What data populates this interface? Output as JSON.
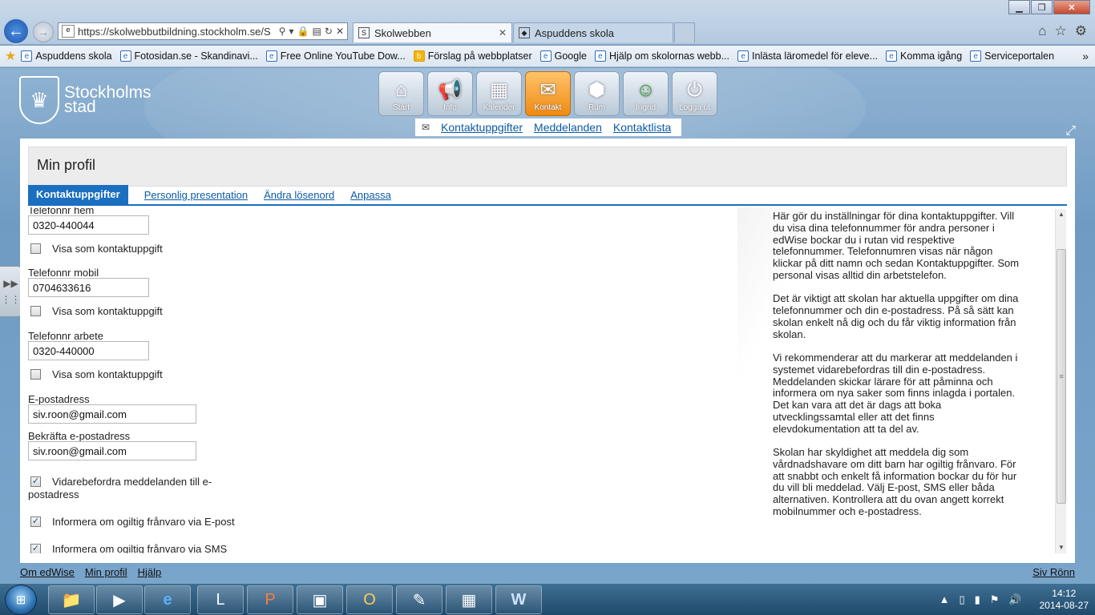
{
  "browser": {
    "url": "https://skolwebbutbildning.stockholm.se/Se",
    "tabs": [
      {
        "title": "Skolwebben",
        "close": "✕"
      },
      {
        "title": "Aspuddens skola"
      }
    ],
    "favorites": [
      "Aspuddens skola",
      "Fotosidan.se - Skandinavi...",
      "Free Online YouTube Dow...",
      "Förslag på webbplatser",
      "Google",
      "Hjälp om skolornas webb...",
      "Inlästa läromedel för eleve...",
      "Komma igång",
      "Serviceportalen"
    ],
    "favorites_more": "»"
  },
  "logo": {
    "line1": "Stockholms",
    "line2": "stad"
  },
  "nav": [
    {
      "label": "Start",
      "icon": "home-icon",
      "glyph": "⌂"
    },
    {
      "label": "Info",
      "icon": "megaphone-icon",
      "glyph": "📢"
    },
    {
      "label": "Kalender",
      "icon": "calendar-icon",
      "glyph": "▦"
    },
    {
      "label": "Kontakt",
      "icon": "envelope-icon",
      "glyph": "✉"
    },
    {
      "label": "Rum",
      "icon": "cube-icon",
      "glyph": "⬢"
    },
    {
      "label": "Ingrid",
      "icon": "user-add-icon",
      "glyph": "☺"
    },
    {
      "label": "Logga ut",
      "icon": "power-icon",
      "glyph": "⏻"
    }
  ],
  "subnav": [
    "Kontaktuppgifter",
    "Meddelanden",
    "Kontaktlista"
  ],
  "page": {
    "title": "Min profil",
    "tabs": [
      "Kontaktuppgifter",
      "Personlig presentation",
      "Ändra lösenord",
      "Anpassa"
    ]
  },
  "form": {
    "phone_home_label": "Telefonnr hem",
    "phone_home_value": "0320-440044",
    "show_contact_label": "Visa som kontaktuppgift",
    "phone_mobile_label": "Telefonnr mobil",
    "phone_mobile_value": "0704633616",
    "phone_work_label": "Telefonnr arbete",
    "phone_work_value": "0320-440000",
    "email_label": "E-postadress",
    "email_value": "siv.roon@gmail.com",
    "email_confirm_label": "Bekräfta e-postadress",
    "email_confirm_value": "siv.roon@gmail.com",
    "forward_label_1": "Vidarebefordra meddelanden till e-",
    "forward_label_2": "postadress",
    "absence_email_label": "Informera om ogiltig frånvaro via E-post",
    "absence_sms_label": "Informera om ogiltig frånvaro via SMS",
    "checks": {
      "show_home": false,
      "show_mobile": false,
      "show_work": false,
      "forward": true,
      "absence_email": true,
      "absence_sms": true
    }
  },
  "help": {
    "p1": "Här gör du inställningar för dina kontaktuppgifter. Vill du visa dina telefonnummer för andra personer i edWise bockar du i rutan vid respektive telefonnummer. Telefonnumren visas när någon klickar på ditt namn och sedan Kontaktuppgifter. Som personal visas alltid din arbetstelefon.",
    "p2": "Det är viktigt att skolan har aktuella uppgifter om dina telefonnummer och din e-postadress. På så sätt kan skolan enkelt nå dig och du får viktig information från skolan.",
    "p3": "Vi rekommenderar att du markerar att meddelanden i systemet vidarebefordras till din e-postadress. Meddelanden skickar lärare för att påminna och informera om nya saker som finns inlagda i portalen. Det kan vara att det är dags att boka utvecklingssamtal eller att det finns elevdokumentation att ta del av.",
    "p4": "Skolan har skyldighet att meddela dig som vårdnadshavare om ditt barn har ogiltig frånvaro. För att snabbt och enkelt få information bockar du för hur du vill bli meddelad. Välj E-post, SMS eller båda alternativen. Kontrollera att du ovan angett korrekt mobilnummer och e-postadress."
  },
  "footer": {
    "links": [
      "Om edWise",
      "Min profil",
      "Hjälp"
    ],
    "user": "Siv Rönn"
  },
  "taskbar": {
    "time": "14:12",
    "date": "2014-08-27"
  }
}
